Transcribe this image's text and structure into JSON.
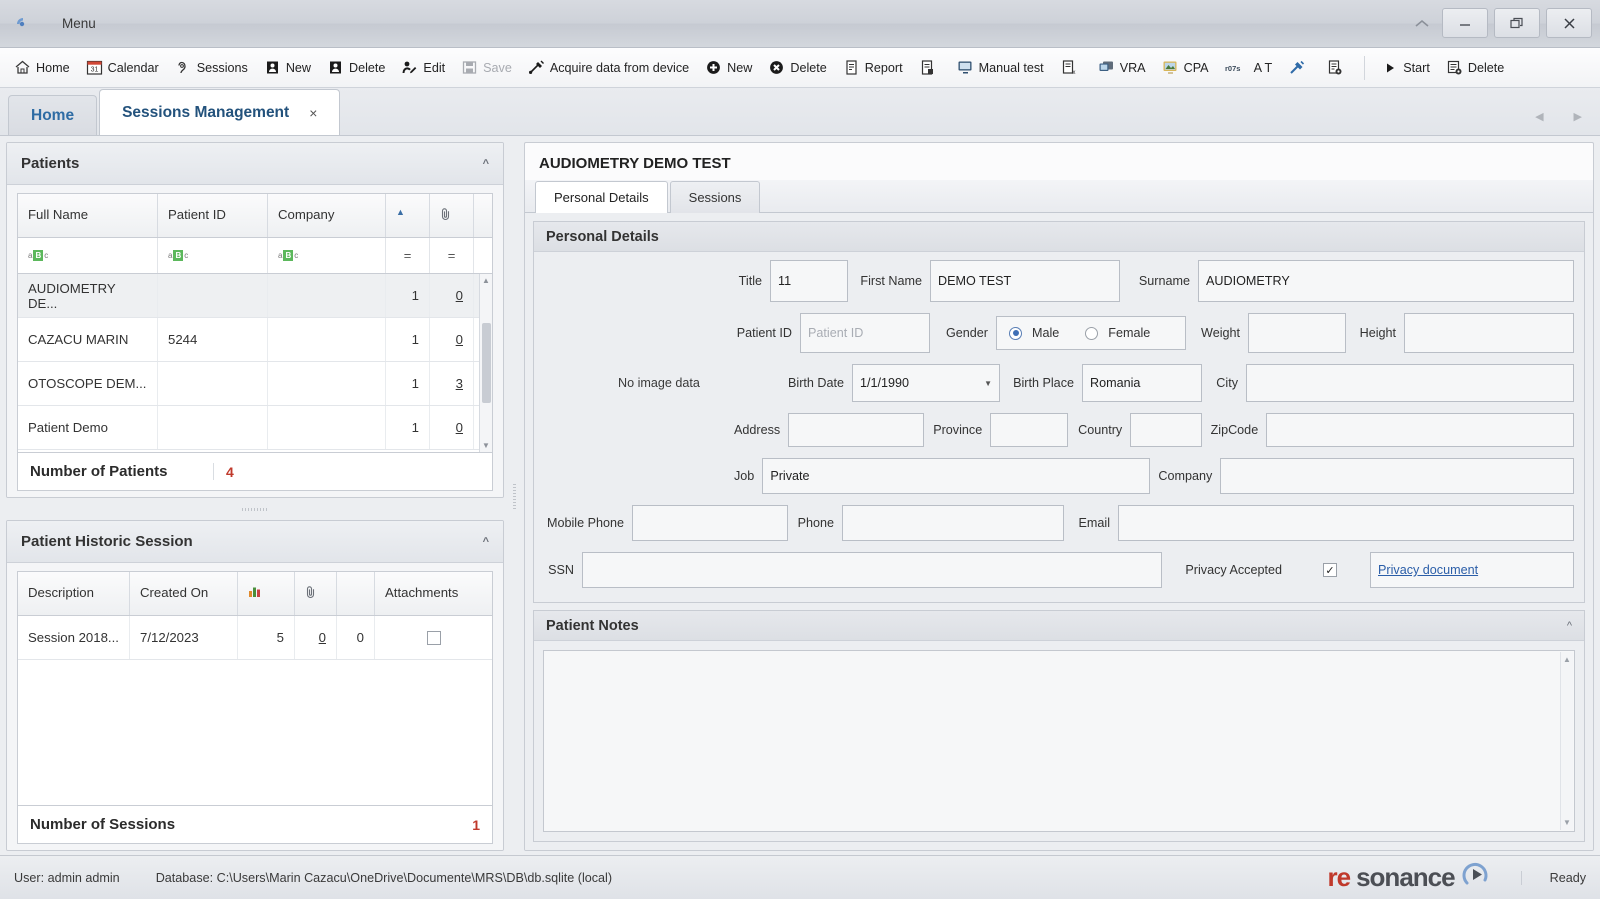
{
  "titlebar": {
    "menu_label": "Menu",
    "app_icon": "resonance-logo-icon",
    "collapse_icon": "chevron-up-icon",
    "minimize_icon": "minimize-icon",
    "restore_icon": "restore-icon",
    "close_icon": "close-icon"
  },
  "toolbar": {
    "items": [
      {
        "label": "Home",
        "icon": "home-icon",
        "disabled": false
      },
      {
        "label": "Calendar",
        "icon": "calendar-icon",
        "disabled": false
      },
      {
        "label": "Sessions",
        "icon": "ear-icon",
        "disabled": false
      },
      {
        "label": "New",
        "icon": "person-new-icon",
        "disabled": false
      },
      {
        "label": "Delete",
        "icon": "person-delete-icon",
        "disabled": false
      },
      {
        "label": "Edit",
        "icon": "person-edit-icon",
        "disabled": false
      },
      {
        "label": "Save",
        "icon": "save-icon",
        "disabled": true
      },
      {
        "label": "Acquire data from device",
        "icon": "usb-device-icon",
        "disabled": false
      },
      {
        "label": "New",
        "icon": "plus-circle-icon",
        "disabled": false
      },
      {
        "label": "Delete",
        "icon": "delete-circle-icon",
        "disabled": false
      },
      {
        "label": "Report",
        "icon": "report-icon",
        "disabled": false
      },
      {
        "label": "",
        "icon": "document-export-icon",
        "disabled": false
      },
      {
        "label": "Manual test",
        "icon": "monitor-manual-icon",
        "disabled": false
      },
      {
        "label": "",
        "icon": "document-excel-icon",
        "disabled": false
      },
      {
        "label": "VRA",
        "icon": "vra-monitor-icon",
        "disabled": false
      },
      {
        "label": "CPA",
        "icon": "cpa-monitor-icon",
        "disabled": false
      },
      {
        "label": "A T",
        "icon": "r07s-logo-icon",
        "disabled": false
      },
      {
        "label": "",
        "icon": "tuning-fork-icon",
        "disabled": false
      },
      {
        "label": "",
        "icon": "document-settings-icon",
        "disabled": false
      }
    ],
    "right_items": [
      {
        "label": "Start",
        "icon": "play-icon",
        "disabled": false
      },
      {
        "label": "Delete",
        "icon": "grid-delete-icon",
        "disabled": false
      }
    ]
  },
  "tabstrip": {
    "tabs": [
      {
        "label": "Home",
        "active": false,
        "closable": false
      },
      {
        "label": "Sessions Management",
        "active": true,
        "closable": true
      }
    ],
    "close_glyph": "×",
    "prev_icon": "chevron-left-icon",
    "next_icon": "chevron-right-icon"
  },
  "patients_panel": {
    "title": "Patients",
    "collapse_icon": "chevron-up-icon",
    "columns": [
      "Full Name",
      "Patient ID",
      "Company",
      "",
      ""
    ],
    "sort_indicator": "▲",
    "attachment_icon": "paperclip-icon",
    "filter_row": [
      "abc-filter-icon",
      "abc-filter-icon",
      "abc-filter-icon",
      "=",
      "="
    ],
    "rows": [
      {
        "full_name": "AUDIOMETRY DE...",
        "patient_id": "",
        "company": "",
        "sessions": "1",
        "attachments": "0",
        "selected": true
      },
      {
        "full_name": "CAZACU MARIN",
        "patient_id": "5244",
        "company": "",
        "sessions": "1",
        "attachments": "0",
        "selected": false
      },
      {
        "full_name": "OTOSCOPE DEM...",
        "patient_id": "",
        "company": "",
        "sessions": "1",
        "attachments": "3",
        "selected": false
      },
      {
        "full_name": "Patient Demo",
        "patient_id": "",
        "company": "",
        "sessions": "1",
        "attachments": "0",
        "selected": false
      }
    ],
    "counter_label": "Number of Patients",
    "counter_value": "4"
  },
  "history_panel": {
    "title": "Patient Historic Session",
    "collapse_icon": "chevron-up-icon",
    "columns": [
      "Description",
      "Created On",
      "chart-icon",
      "paperclip-icon",
      "",
      "Attachments"
    ],
    "rows": [
      {
        "description": "Session 2018...",
        "created_on": "7/12/2023",
        "tests": "5",
        "notes": "0",
        "count": "0",
        "attachments_checkbox": false
      }
    ],
    "counter_label": "Number of Sessions",
    "counter_value": "1"
  },
  "detail": {
    "title": "AUDIOMETRY DEMO TEST",
    "tabs": [
      {
        "label": "Personal Details",
        "active": true
      },
      {
        "label": "Sessions",
        "active": false
      }
    ],
    "personal_details": {
      "box_title": "Personal Details",
      "no_image_text": "No image data",
      "fields": {
        "title_label": "Title",
        "title_value": "11",
        "first_name_label": "First Name",
        "first_name_value": "DEMO TEST",
        "surname_label": "Surname",
        "surname_value": "AUDIOMETRY",
        "patient_id_label": "Patient ID",
        "patient_id_value": "",
        "patient_id_placeholder": "Patient ID",
        "gender_label": "Gender",
        "gender_male": "Male",
        "gender_female": "Female",
        "gender_selected": "Male",
        "weight_label": "Weight",
        "weight_value": "",
        "height_label": "Height",
        "height_value": "",
        "birth_date_label": "Birth Date",
        "birth_date_value": "1/1/1990",
        "birth_place_label": "Birth Place",
        "birth_place_value": "Romania",
        "city_label": "City",
        "city_value": "",
        "address_label": "Address",
        "address_value": "",
        "province_label": "Province",
        "province_value": "",
        "country_label": "Country",
        "country_value": "",
        "zipcode_label": "ZipCode",
        "zipcode_value": "",
        "job_label": "Job",
        "job_value": "Private",
        "company_label": "Company",
        "company_value": "",
        "mobile_phone_label": "Mobile Phone",
        "mobile_phone_value": "",
        "phone_label": "Phone",
        "phone_value": "",
        "email_label": "Email",
        "email_value": "",
        "ssn_label": "SSN",
        "ssn_value": "",
        "privacy_accepted_label": "Privacy Accepted",
        "privacy_accepted_checked": true,
        "privacy_check_glyph": "✓",
        "privacy_document_link": "Privacy document"
      }
    },
    "notes": {
      "box_title": "Patient Notes",
      "collapse_icon": "chevron-up-icon",
      "value": ""
    }
  },
  "statusbar": {
    "user": "User: admin admin",
    "database": "Database: C:\\Users\\Marin Cazacu\\OneDrive\\Documente\\MRS\\DB\\db.sqlite (local)",
    "brand_prefix": "re",
    "brand_suffix": "sonance",
    "brand_icon": "resonance-arc-icon",
    "ready": "Ready"
  }
}
